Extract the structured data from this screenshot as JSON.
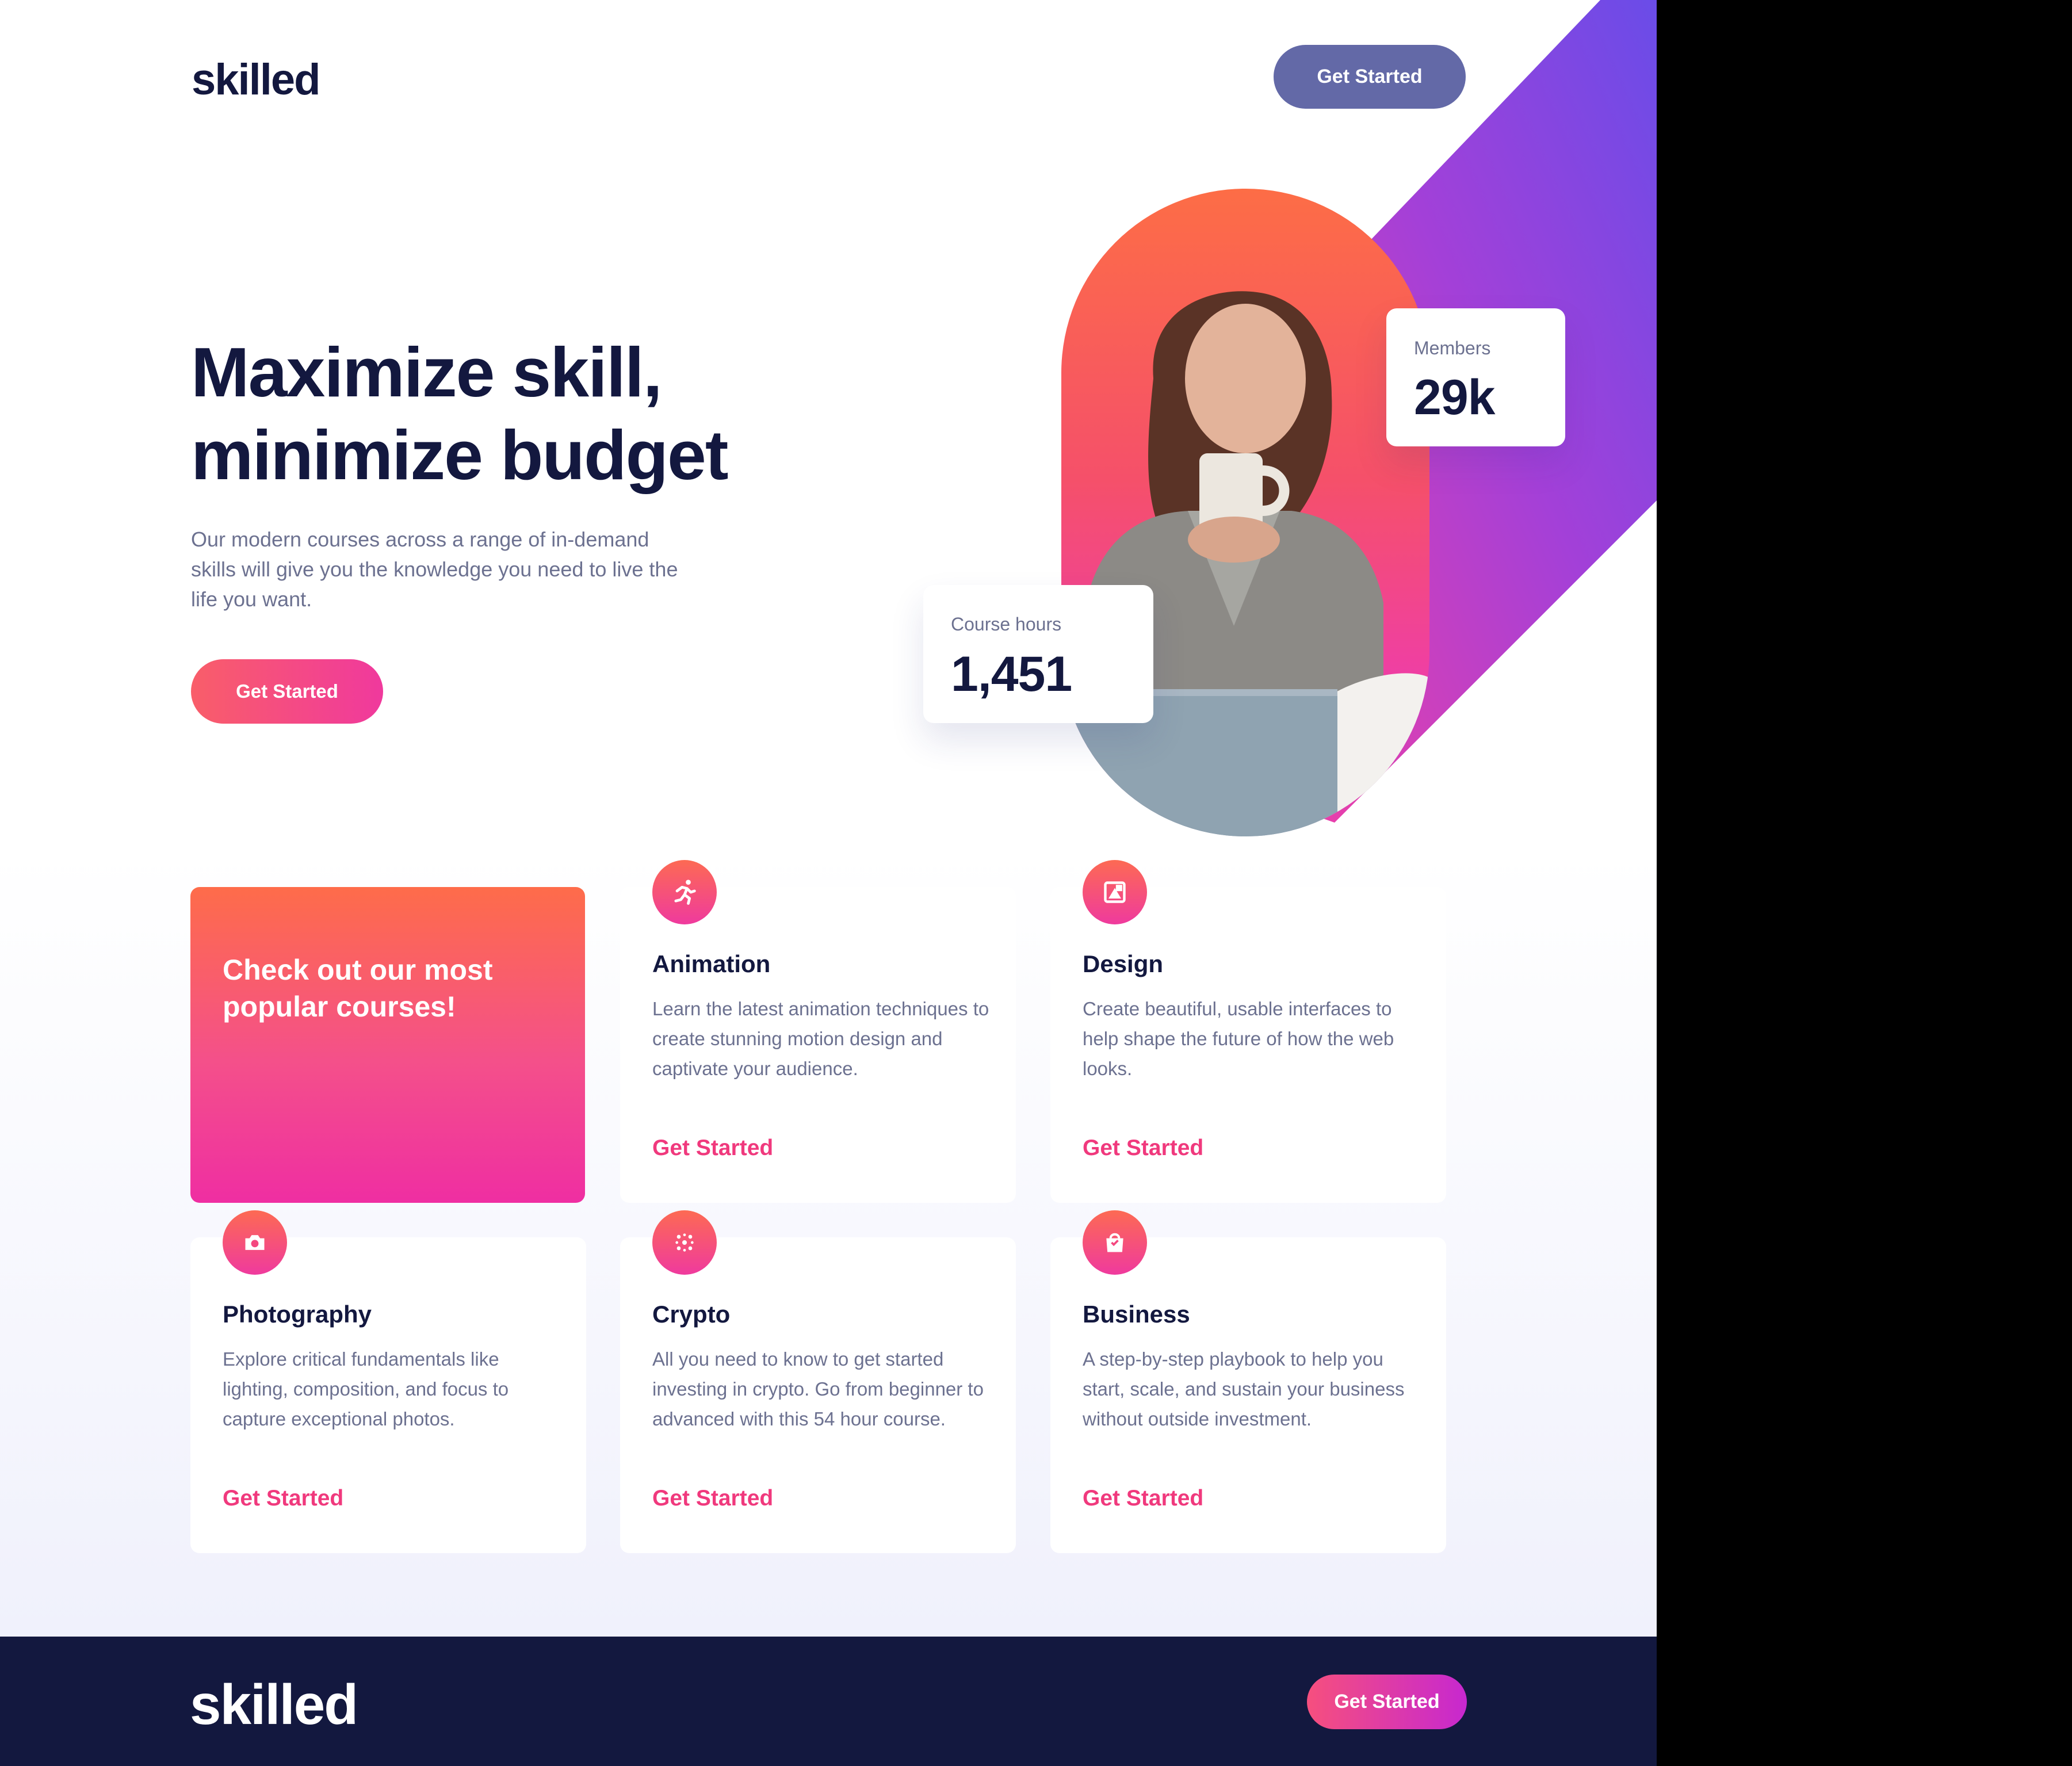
{
  "header": {
    "logo": "skilled",
    "cta_label": "Get Started"
  },
  "hero": {
    "title_line1": "Maximize skill,",
    "title_line2": "minimize budget",
    "description": "Our modern courses across a range of in-demand skills will give you the knowledge you need to live the life you want.",
    "cta_label": "Get Started",
    "stats": {
      "members": {
        "label": "Members",
        "value": "29k"
      },
      "course_hours": {
        "label": "Course hours",
        "value": "1,451"
      }
    }
  },
  "courses": {
    "intro": "Check out our most popular courses!",
    "items": [
      {
        "title": "Animation",
        "description": "Learn the latest animation techniques to create stunning motion design and captivate your audience.",
        "link": "Get Started",
        "icon": "running-person-icon"
      },
      {
        "title": "Design",
        "description": "Create beautiful, usable interfaces to help shape the future of how the web looks.",
        "link": "Get Started",
        "icon": "design-frame-icon"
      },
      {
        "title": "Photography",
        "description": "Explore critical fundamentals like lighting, composition, and focus to capture exceptional photos.",
        "link": "Get Started",
        "icon": "camera-icon"
      },
      {
        "title": "Crypto",
        "description": "All you need to know to get started investing in crypto. Go from beginner to advanced with this 54 hour course.",
        "link": "Get Started",
        "icon": "crypto-dots-icon"
      },
      {
        "title": "Business",
        "description": "A step-by-step playbook to help you start, scale, and sustain your business without outside investment.",
        "link": "Get Started",
        "icon": "shopping-bag-icon"
      }
    ]
  },
  "footer": {
    "logo": "skilled",
    "cta_label": "Get Started"
  },
  "colors": {
    "navy": "#13183f",
    "header_button": "#6369a7",
    "accent_pink": "#f0397d",
    "gradient_orange": "#fe6c4a",
    "gradient_purple": "#6a4ce8"
  }
}
